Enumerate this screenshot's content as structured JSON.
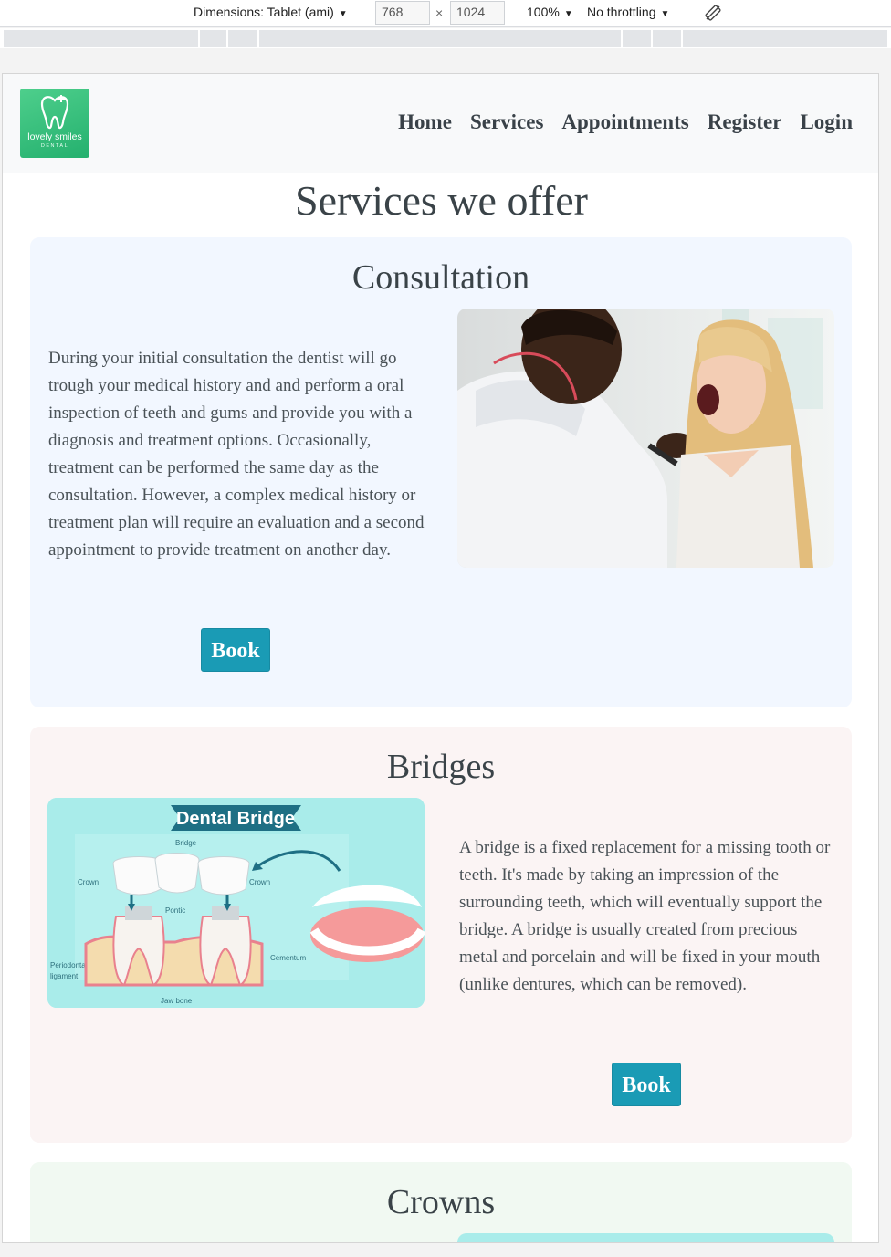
{
  "devtools": {
    "dimensions_label": "Dimensions: Tablet (ami)",
    "width": "768",
    "times": "×",
    "height": "1024",
    "zoom": "100%",
    "throttling": "No throttling",
    "caret": "▼"
  },
  "logo": {
    "brand": "lovely smiles",
    "sub": "DENTAL"
  },
  "nav": [
    "Home",
    "Services",
    "Appointments",
    "Register",
    "Login"
  ],
  "page_title": "Services we offer",
  "services": [
    {
      "title": "Consultation",
      "text": "During your initial consultation the dentist will go trough your medical history and and perform a oral inspection of teeth and gums and provide you with a diagnosis and treatment options. Occasionally, treatment can be performed the same day as the consultation. However, a complex medical history or treatment plan will require an evaluation and a second appointment to provide treatment on another day.",
      "button": "Book"
    },
    {
      "title": "Bridges",
      "text": "A bridge is a fixed replacement for a missing tooth or teeth. It's made by taking an impression of the surrounding teeth, which will eventually support the bridge. A bridge is usually created from precious metal and porcelain and will be fixed in your mouth (unlike dentures, which can be removed).",
      "button": "Book",
      "diagram": {
        "title": "Dental Bridge",
        "labels": [
          "Bridge",
          "Crown",
          "Crown",
          "Pontic",
          "Cementum",
          "Periodontal",
          "ligament",
          "Jaw bone"
        ]
      }
    },
    {
      "title": "Crowns"
    }
  ],
  "colors": {
    "button": "#1a9bb5",
    "logo": "#2fbd7a",
    "consult_bg": "#f2f7ff",
    "bridges_bg": "#fbf4f4",
    "crowns_bg": "#f1f9f2"
  }
}
